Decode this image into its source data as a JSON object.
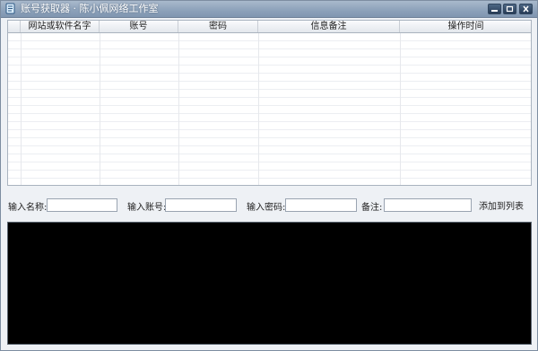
{
  "window": {
    "title": "账号获取器 · 陈小佩网络工作室",
    "controls": {
      "minimize": "minimize",
      "restore": "restore",
      "close": "close"
    }
  },
  "table": {
    "columns": [
      "网站或软件名字",
      "账号",
      "密码",
      "信息备注",
      "操作时间"
    ],
    "rows": []
  },
  "form": {
    "name_label": "输入名称:",
    "name_value": "",
    "account_label": "输入账号:",
    "account_value": "",
    "password_label": "输入密码:",
    "password_value": "",
    "note_label": "备注:",
    "note_value": "",
    "add_button": "添加到列表"
  },
  "log": {
    "content": ""
  },
  "colors": {
    "titlebar": "#8ea3bb",
    "log_background": "#000000"
  }
}
